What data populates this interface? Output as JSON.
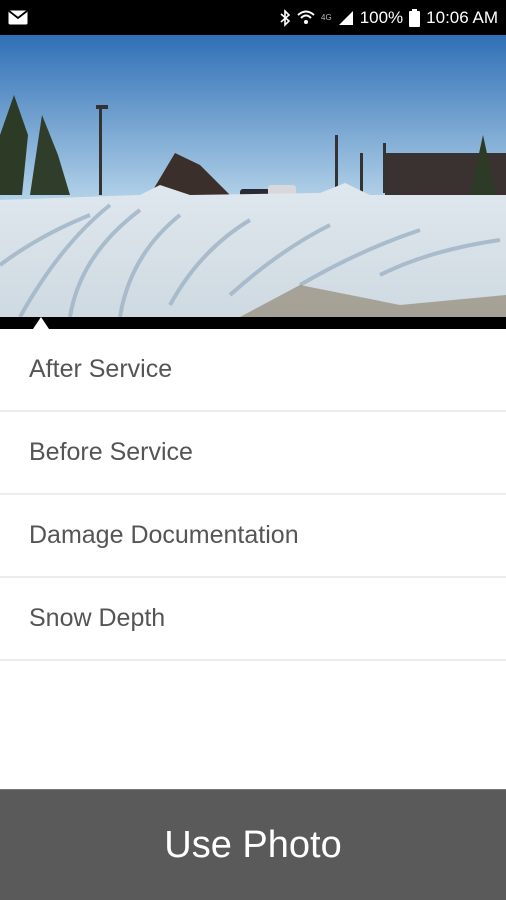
{
  "status_bar": {
    "battery": "100%",
    "time": "10:06 AM",
    "network": "4G",
    "icons": [
      "mail-icon",
      "bluetooth-icon",
      "wifi-icon",
      "signal-icon",
      "battery-icon"
    ]
  },
  "photo": {
    "description_icon": "snow-parking-lot-photo"
  },
  "list": {
    "items": [
      {
        "label": "After Service"
      },
      {
        "label": "Before Service"
      },
      {
        "label": "Damage Documentation"
      },
      {
        "label": "Snow Depth"
      }
    ]
  },
  "footer": {
    "use_photo_label": "Use Photo",
    "button_color": "#5a5a5a"
  }
}
